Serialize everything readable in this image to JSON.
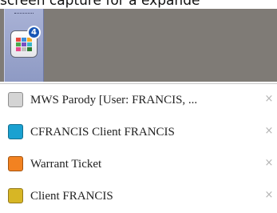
{
  "caption": "screen capture for a expande",
  "taskbar": {
    "group_icon": "app-grid-icon",
    "badge_count": "4",
    "tile_colors": [
      "#e8483f",
      "#3b8fdc",
      "#f3a92a",
      "#4aa84a",
      "#7a4fc3",
      "#3bb6c8",
      "#e84a8a",
      "#bdbdbd",
      "#2e7d32"
    ]
  },
  "window_list": {
    "items": [
      {
        "label": "MWS Parody   [User: FRANCIS, ...",
        "swatch_color": "#d4d4d4",
        "swatch_border": "#8e8e8e",
        "close_icon": "close-icon"
      },
      {
        "label": "CFRANCIS Client FRANCIS",
        "swatch_color": "#1aa1d1",
        "swatch_border": "#136f8f",
        "close_icon": "close-icon"
      },
      {
        "label": "Warrant Ticket",
        "swatch_color": "#f28221",
        "swatch_border": "#a5540f",
        "close_icon": "close-icon"
      },
      {
        "label": "Client FRANCIS",
        "swatch_color": "#d7b625",
        "swatch_border": "#93791a",
        "close_icon": "close-icon"
      }
    ],
    "close_glyph": "×"
  }
}
